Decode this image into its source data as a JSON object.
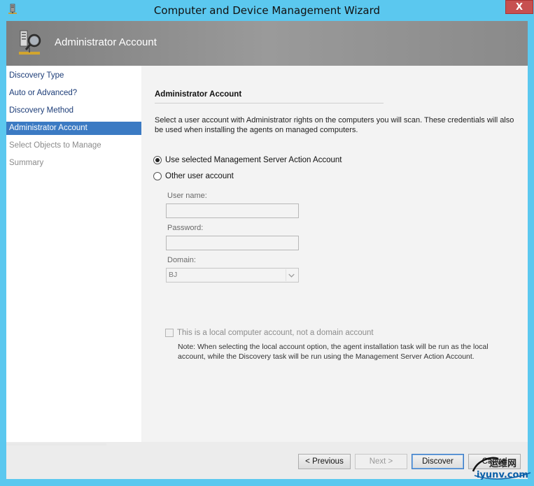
{
  "window": {
    "title": "Computer and Device Management Wizard",
    "close_label": "X",
    "accent_color": "#5bc8ef"
  },
  "banner": {
    "title": "Administrator Account",
    "icon": "server-network-icon"
  },
  "nav": {
    "items": [
      {
        "label": "Discovery Type",
        "state": "normal"
      },
      {
        "label": "Auto or Advanced?",
        "state": "normal"
      },
      {
        "label": "Discovery Method",
        "state": "normal"
      },
      {
        "label": "Administrator Account",
        "state": "selected"
      },
      {
        "label": "Select Objects to Manage",
        "state": "disabled"
      },
      {
        "label": "Summary",
        "state": "disabled"
      }
    ],
    "selected_color": "#3b7ac3"
  },
  "main": {
    "section_title": "Administrator Account",
    "description": "Select a user account with Administrator rights on the computers you will scan. These credentials will also be used when installing the agents on managed computers.",
    "options": {
      "use_selected": {
        "label": "Use selected Management Server Action Account",
        "checked": true
      },
      "other_account": {
        "label": "Other user account",
        "checked": false
      }
    },
    "fields": {
      "username_label": "User name:",
      "username_value": "",
      "password_label": "Password:",
      "password_value": "",
      "domain_label": "Domain:",
      "domain_value": "BJ"
    },
    "local_account": {
      "label": "This is a local computer account, not a domain account",
      "checked": false
    },
    "note": "Note:  When selecting the local account option, the agent installation task will be run as the local account, while the Discovery task will be run using the Management Server Action Account."
  },
  "buttons": {
    "previous": "< Previous",
    "next": "Next >",
    "discover": "Discover",
    "cancel": "Cancel"
  },
  "watermark": {
    "cn": "运维网",
    "site": "iyunv.com"
  }
}
